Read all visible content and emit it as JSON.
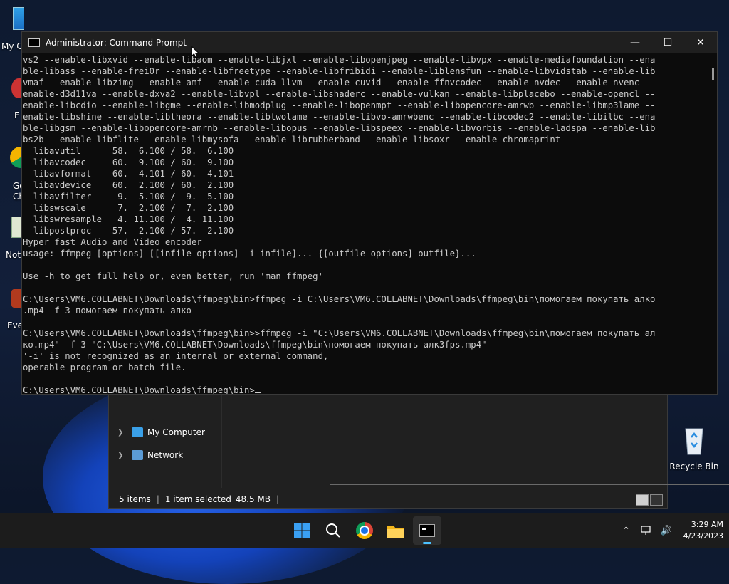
{
  "desktop": {
    "left_labels": [
      "My C",
      "F",
      "Go",
      "Ch",
      "Not",
      "Eve"
    ],
    "recycle_bin_label": "Recycle Bin"
  },
  "explorer": {
    "nav": [
      "My Computer",
      "Network"
    ],
    "status_items": "5 items",
    "status_selected": "1 item selected",
    "status_size": "48.5 MB",
    "status_sep": "|"
  },
  "cmd": {
    "title": "Administrator: Command Prompt",
    "lines": [
      "vs2 --enable-libxvid --enable-libaom --enable-libjxl --enable-libopenjpeg --enable-libvpx --enable-mediafoundation --ena",
      "ble-libass --enable-frei0r --enable-libfreetype --enable-libfribidi --enable-liblensfun --enable-libvidstab --enable-lib",
      "vmaf --enable-libzimg --enable-amf --enable-cuda-llvm --enable-cuvid --enable-ffnvcodec --enable-nvdec --enable-nvenc --",
      "enable-d3d11va --enable-dxva2 --enable-libvpl --enable-libshaderc --enable-vulkan --enable-libplacebo --enable-opencl --",
      "enable-libcdio --enable-libgme --enable-libmodplug --enable-libopenmpt --enable-libopencore-amrwb --enable-libmp3lame --",
      "enable-libshine --enable-libtheora --enable-libtwolame --enable-libvo-amrwbenc --enable-libcodec2 --enable-libilbc --ena",
      "ble-libgsm --enable-libopencore-amrnb --enable-libopus --enable-libspeex --enable-libvorbis --enable-ladspa --enable-lib",
      "bs2b --enable-libflite --enable-libmysofa --enable-librubberband --enable-libsoxr --enable-chromaprint",
      "  libavutil      58.  6.100 / 58.  6.100",
      "  libavcodec     60.  9.100 / 60.  9.100",
      "  libavformat    60.  4.101 / 60.  4.101",
      "  libavdevice    60.  2.100 / 60.  2.100",
      "  libavfilter     9.  5.100 /  9.  5.100",
      "  libswscale      7.  2.100 /  7.  2.100",
      "  libswresample   4. 11.100 /  4. 11.100",
      "  libpostproc    57.  2.100 / 57.  2.100",
      "Hyper fast Audio and Video encoder",
      "usage: ffmpeg [options] [[infile options] -i infile]... {[outfile options] outfile}...",
      "",
      "Use -h to get full help or, even better, run 'man ffmpeg'",
      "",
      "C:\\Users\\VM6.COLLABNET\\Downloads\\ffmpeg\\bin>ffmpeg -i C:\\Users\\VM6.COLLABNET\\Downloads\\ffmpeg\\bin\\помогаем покупать алко",
      ".mp4 -f 3 помогаем покупать алко",
      "",
      "C:\\Users\\VM6.COLLABNET\\Downloads\\ffmpeg\\bin>>ffmpeg -i \"C:\\Users\\VM6.COLLABNET\\Downloads\\ffmpeg\\bin\\помогаем покупать ал",
      "ко.mp4\" -f 3 \"C:\\Users\\VM6.COLLABNET\\Downloads\\ffmpeg\\bin\\помогаем покупать алк3fps.mp4\"",
      "'-i' is not recognized as an internal or external command,",
      "operable program or batch file.",
      "",
      "C:\\Users\\VM6.COLLABNET\\Downloads\\ffmpeg\\bin>"
    ]
  },
  "taskbar": {
    "apps": [
      "start-icon",
      "search-icon",
      "chrome-icon",
      "file-explorer-icon",
      "command-prompt-icon"
    ],
    "time": "3:29 AM",
    "date": "4/23/2023"
  }
}
